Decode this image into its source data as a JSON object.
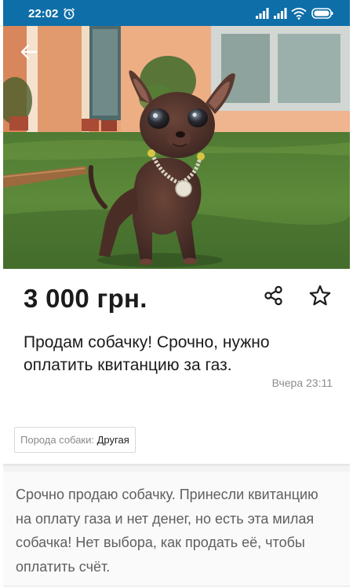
{
  "status_bar": {
    "time": "22:02",
    "icons": [
      "alarm-icon",
      "signal-icon",
      "signal-icon",
      "wifi-icon",
      "battery-icon"
    ]
  },
  "navigation": {
    "back_icon": "arrow-left-icon"
  },
  "listing": {
    "price": "3 000 грн.",
    "title": "Продам собачку! Срочно, нужно оплатить квитанцию за газ.",
    "date": "Вчера 23:11",
    "actions": [
      "share-icon",
      "star-icon"
    ],
    "params": [
      {
        "key": "Порода собаки:",
        "value": "Другая"
      }
    ],
    "description": "Срочно продаю собачку. Принесли квитанцию на оплату газа и нет денег, но есть эта милая собачка! Нет выбора, как продать её, чтобы оплатить счёт."
  },
  "colors": {
    "status_bar": "#0e6ea8",
    "text_primary": "#1b1b1b",
    "text_secondary": "#8c8c8c"
  }
}
